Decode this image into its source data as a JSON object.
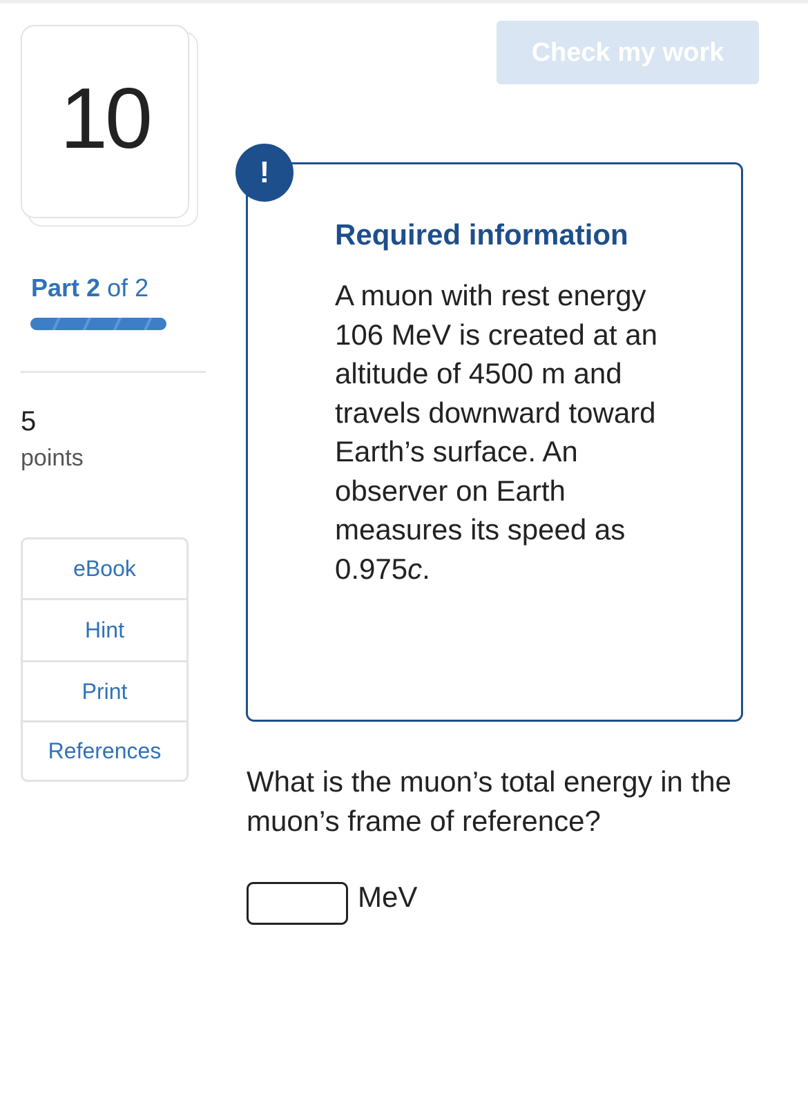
{
  "question": {
    "number": "10"
  },
  "part": {
    "prefix": "Part",
    "current": "2",
    "separator": "of 2",
    "progress_fraction": 1.0
  },
  "points": {
    "value": "5",
    "label": "points"
  },
  "tools": [
    {
      "label": "eBook"
    },
    {
      "label": "Hint"
    },
    {
      "label": "Print"
    },
    {
      "label": "References"
    }
  ],
  "check_button": {
    "label": "Check my work"
  },
  "required_info": {
    "badge": "!",
    "title": "Required information",
    "text_main": "A muon with rest energy 106 MeV is created at an altitude of 4500 m and travels downward toward Earth’s surface. An observer on Earth measures its speed as 0.975",
    "text_symbol": "c",
    "text_end": "."
  },
  "prompt": {
    "question": "What is the muon’s total energy in the muon’s frame of reference?",
    "answer_value": "",
    "unit": "MeV"
  },
  "colors": {
    "link_blue": "#2f72b8",
    "dark_blue": "#1d4f8c",
    "check_button_bg": "#d9e5f2"
  }
}
